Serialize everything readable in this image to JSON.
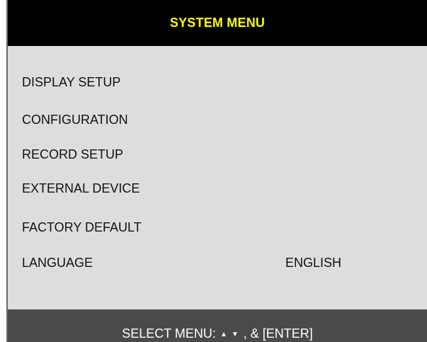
{
  "title": "SYSTEM MENU",
  "menu_items": [
    {
      "label": "DISPLAY SETUP",
      "value": ""
    },
    {
      "label": "CONFIGURATION",
      "value": ""
    },
    {
      "label": "RECORD SETUP",
      "value": ""
    },
    {
      "label": "EXTERNAL DEVICE",
      "value": ""
    },
    {
      "label": "FACTORY DEFAULT",
      "value": ""
    },
    {
      "label": "LANGUAGE",
      "value": "ENGLISH"
    }
  ],
  "footer": {
    "prefix": "SELECT MENU:",
    "up_arrow": "▲",
    "down_arrow": "▼",
    "suffix": ", & [ENTER]"
  },
  "colors": {
    "title_bg": "#000000",
    "title_text": "#ffff00",
    "body_bg": "#dddddd",
    "footer_bg": "#4a4a4a",
    "footer_text": "#ffffff"
  },
  "icons": [
    "up-arrow-icon",
    "down-arrow-icon"
  ]
}
